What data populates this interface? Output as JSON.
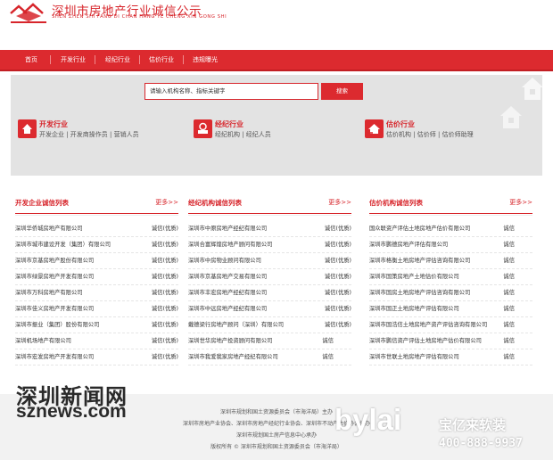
{
  "header": {
    "title": "深圳市房地产行业诚信公示",
    "pinyin": "SHEN ZHEN SHI FANG DI CHAN HANG YE CHENG XIN GONG SHI"
  },
  "colors": {
    "brand_red": "#dc2a2f",
    "banner_gray": "#e3e3e3"
  },
  "nav": {
    "items": [
      "首页",
      "开发行业",
      "经纪行业",
      "估价行业",
      "违规曝光"
    ]
  },
  "search": {
    "value": "请输入机构名称、指标关键字",
    "button": "搜索"
  },
  "categories": [
    {
      "title": "开发行业",
      "links": "开发企业 | 开发商操作员 | 营销人员",
      "icon": "house-icon"
    },
    {
      "title": "经纪行业",
      "links": "经纪机构 | 经纪人员",
      "icon": "stamp-icon"
    },
    {
      "title": "估价行业",
      "links": "估价机构 | 估价师 | 估价师助理",
      "icon": "arrow-house-icon"
    }
  ],
  "columns": [
    {
      "title": "开发企业诚信列表",
      "more": "更多>>",
      "rows": [
        {
          "name": "深圳华侨城房地产有限公司",
          "badge": "诚信(优质)"
        },
        {
          "name": "深圳市城市建设开发（集团）有限公司",
          "badge": "诚信(优质)"
        },
        {
          "name": "深圳市京基房地产股份有限公司",
          "badge": "诚信(优质)"
        },
        {
          "name": "深圳市绿景房地产开发有限公司",
          "badge": "诚信(优质)"
        },
        {
          "name": "深圳市万科房地产有限公司",
          "badge": "诚信(优质)"
        },
        {
          "name": "深圳市佳义房地产开发有限公司",
          "badge": "诚信(优质)"
        },
        {
          "name": "深圳市振业（集团）股份有限公司",
          "badge": "诚信(优质)"
        },
        {
          "name": "深圳机场地产有限公司",
          "badge": "诚信(优质)"
        },
        {
          "name": "深圳市宏发房地产开发有限公司",
          "badge": "诚信(优质)"
        }
      ]
    },
    {
      "title": "经纪机构诚信列表",
      "more": "更多>>",
      "rows": [
        {
          "name": "深圳市中原房地产经纪有限公司",
          "badge": "诚信(优质)"
        },
        {
          "name": "深圳合富辉煌房地产顾问有限公司",
          "badge": "诚信(优质)"
        },
        {
          "name": "深圳市中房物业顾问有限公司",
          "badge": "诚信(优质)"
        },
        {
          "name": "深圳市京基房地产交易有限公司",
          "badge": "诚信(优质)"
        },
        {
          "name": "深圳市丰宏房地产经纪有限公司",
          "badge": "诚信(优质)"
        },
        {
          "name": "深圳市中远房地产经纪有限公司",
          "badge": "诚信(优质)"
        },
        {
          "name": "戴德梁行房地产顾问（深圳）有限公司",
          "badge": "诚信(优质)"
        },
        {
          "name": "深圳世华房地产投资顾问有限公司",
          "badge": "诚信"
        },
        {
          "name": "深圳市我爱我家房地产经纪有限公司",
          "badge": "诚信"
        }
      ]
    },
    {
      "title": "估价机构诚信列表",
      "more": "更多>>",
      "rows": [
        {
          "name": "国众联资产评估土地房地产估价有限公司",
          "badge": "诚信"
        },
        {
          "name": "深圳市鹏德房地产评估有限公司",
          "badge": "诚信"
        },
        {
          "name": "深圳市格衡土地房地产评估咨询有限公司",
          "badge": "诚信"
        },
        {
          "name": "深圳市国策房地产土地估价有限公司",
          "badge": "诚信"
        },
        {
          "name": "深圳市国房土地房地产评估咨询有限公司",
          "badge": "诚信"
        },
        {
          "name": "深圳市国正土地房地产评估有限公司",
          "badge": "诚信"
        },
        {
          "name": "深圳市国浩信土地房地产资产评估咨询有限公司",
          "badge": "诚信"
        },
        {
          "name": "深圳市鹏信资产评估土地房地产估价有限公司",
          "badge": "诚信"
        },
        {
          "name": "深圳市世联土地房地产评估有限公司",
          "badge": "诚信"
        }
      ]
    }
  ],
  "footer": {
    "line1": "深圳市规划和国土资源委员会（市海洋局）主办",
    "line2": "深圳市房地产业协会、深圳市房地产经纪行业协会、深圳市不动产估价协会协办",
    "line3": "深圳市规划国土房产信息中心承办",
    "line4": "版权所有 © 深圳市规划和国土资源委员会（市海洋局）"
  },
  "watermarks": {
    "sz_cn": "深圳新闻网",
    "sz_en": "sznews.com",
    "bylai": "bylai",
    "bylai_cn": "宝亿来软装",
    "phone": "400-888-9937"
  }
}
